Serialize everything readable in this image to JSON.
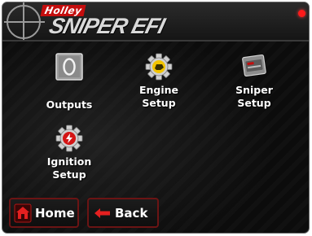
{
  "header": {
    "brand": "Holley",
    "product": "SNIPER EFI"
  },
  "menu": {
    "outputs": {
      "label": "Outputs",
      "icon": "square-o-icon"
    },
    "engine_setup": {
      "label": "Engine\nSetup",
      "icon": "yellow-gear-icon"
    },
    "sniper_setup": {
      "label": "Sniper\nSetup",
      "icon": "sniper-unit-icon"
    },
    "ignition_setup": {
      "label": "Ignition\nSetup",
      "icon": "red-spark-gear-icon"
    }
  },
  "nav": {
    "home_label": "Home",
    "back_label": "Back"
  },
  "colors": {
    "accent_red": "#c40d0d",
    "gear_yellow": "#f2c400",
    "status_red": "#ff1a1a"
  }
}
